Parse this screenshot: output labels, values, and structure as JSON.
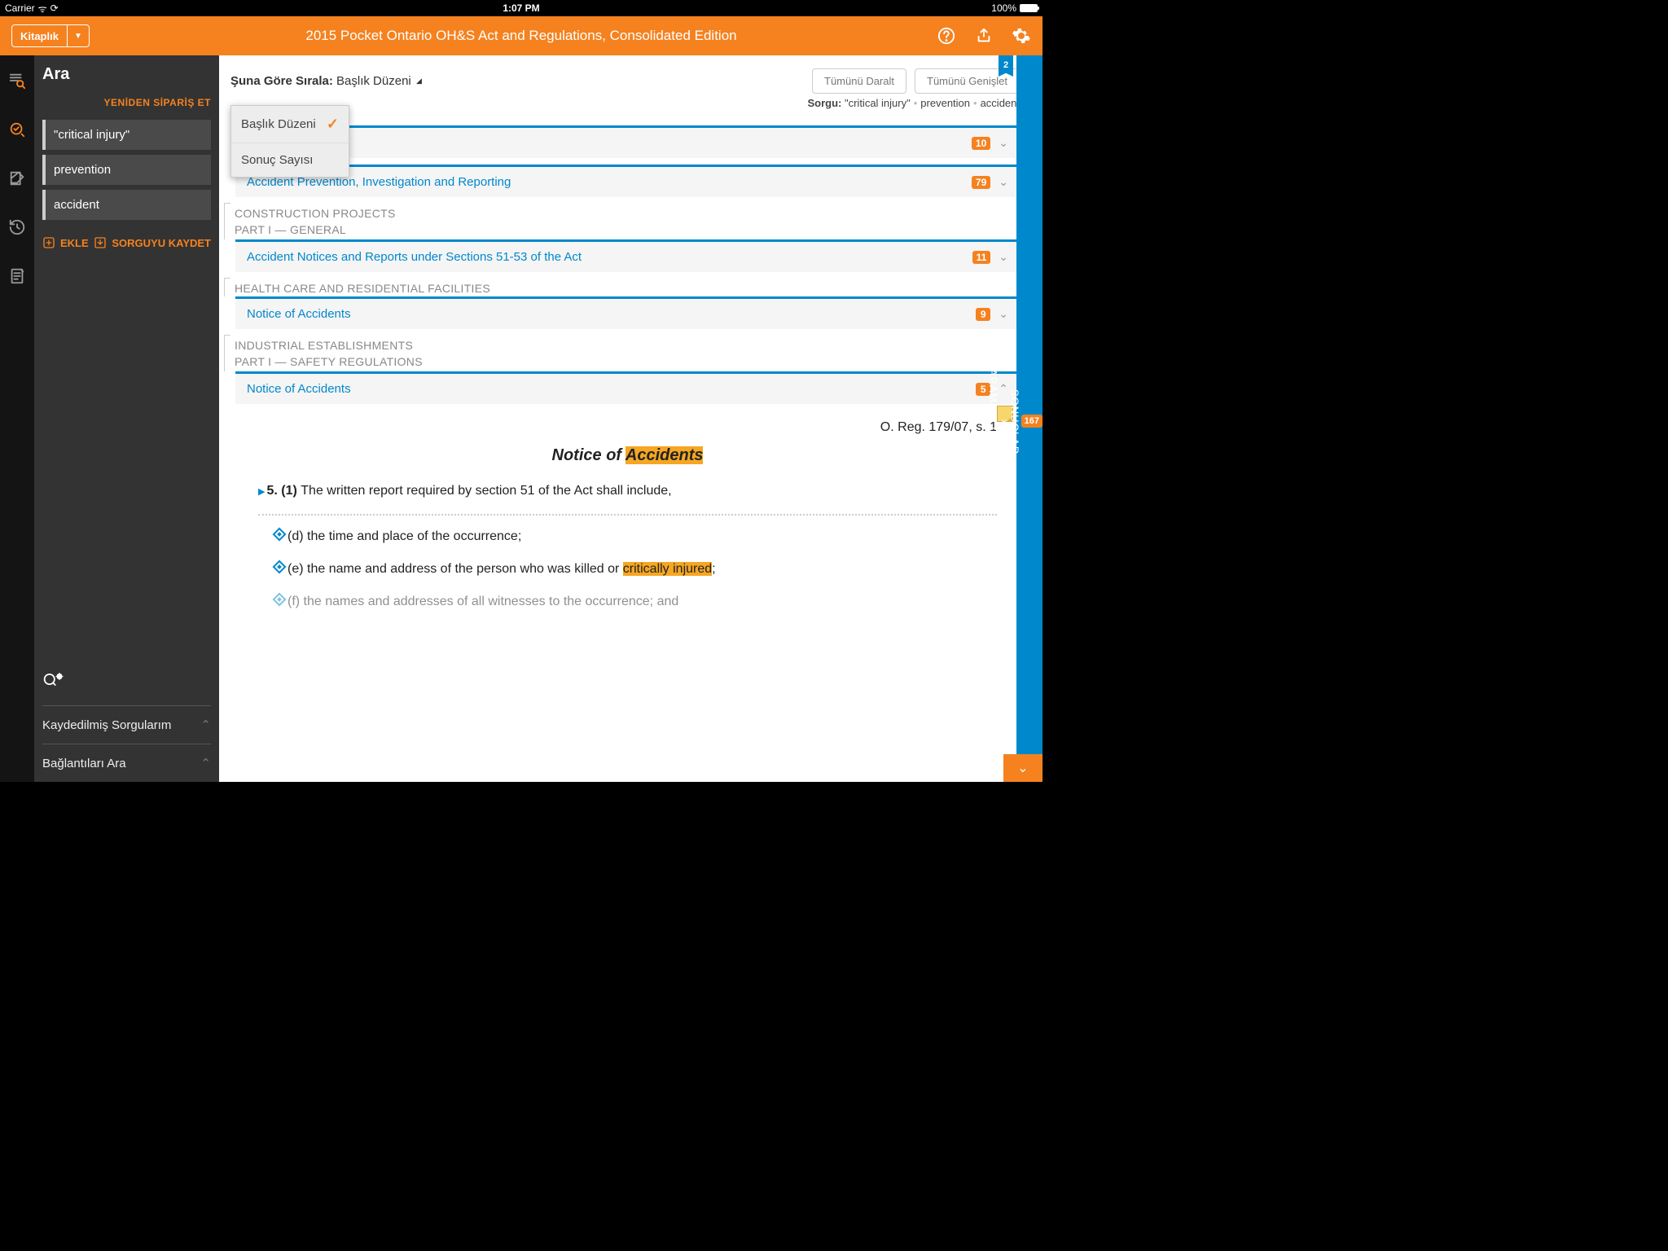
{
  "status": {
    "carrier": "Carrier",
    "time": "1:07 PM",
    "battery": "100%"
  },
  "header": {
    "library": "Kitaplık",
    "title": "2015 Pocket Ontario OH&S Act and Regulations, Consolidated Edition"
  },
  "sidebar": {
    "title": "Ara",
    "reorder": "YENİDEN SİPARİŞ ET",
    "terms": [
      "\"critical injury\"",
      "prevention",
      "accident"
    ],
    "add": "EKLE",
    "save": "SORGUYU KAYDET",
    "saved_queries": "Kaydedilmiş Sorgularım",
    "search_links": "Bağlantıları Ara"
  },
  "sort": {
    "label": "Şuna Göre Sırala:",
    "value": "Başlık Düzeni",
    "options": [
      "Başlık Düzeni",
      "Sonuç Sayısı"
    ],
    "collapse_all": "Tümünü Daralt",
    "expand_all": "Tümünü Genişlet"
  },
  "query": {
    "label": "Sorgu:",
    "terms": [
      "\"critical injury\"",
      "prevention",
      "accident"
    ]
  },
  "results": [
    {
      "title_hidden": true,
      "count": "10"
    },
    {
      "title": "Accident Prevention, Investigation and Reporting",
      "count": "79"
    },
    {
      "headings": [
        "CONSTRUCTION PROJECTS",
        "PART I — GENERAL"
      ],
      "title": "Accident Notices and Reports under Sections 51-53 of the Act",
      "count": "11"
    },
    {
      "headings": [
        "HEALTH CARE AND RESIDENTIAL FACILITIES"
      ],
      "title": "Notice of Accidents",
      "count": "9"
    },
    {
      "headings": [
        "INDUSTRIAL ESTABLISHMENTS",
        "PART I — SAFETY REGULATIONS"
      ],
      "title": "Notice of Accidents",
      "count": "5",
      "expanded": true
    }
  ],
  "article": {
    "reg": "O. Reg. 179/07, s. 1",
    "heading_prefix": "Notice of ",
    "heading_hl": "Accidents",
    "p1_lead": "5. (1) ",
    "p1_rest": "The written report required by section 51 of the Act shall include,",
    "p2": "(d) the time and place of the occurrence;",
    "p3_pre": "(e) the name and address of the person who was killed or ",
    "p3_hl": "critically injured",
    "p3_post": ";",
    "p4": "(f) the names and addresses of all witnesses to the occurrence; and"
  },
  "rail": {
    "bookmark": "2",
    "results_count": "167",
    "results_label": "SONUÇLAR",
    "clear_label": "ARAMAYI TEMİZLE"
  }
}
